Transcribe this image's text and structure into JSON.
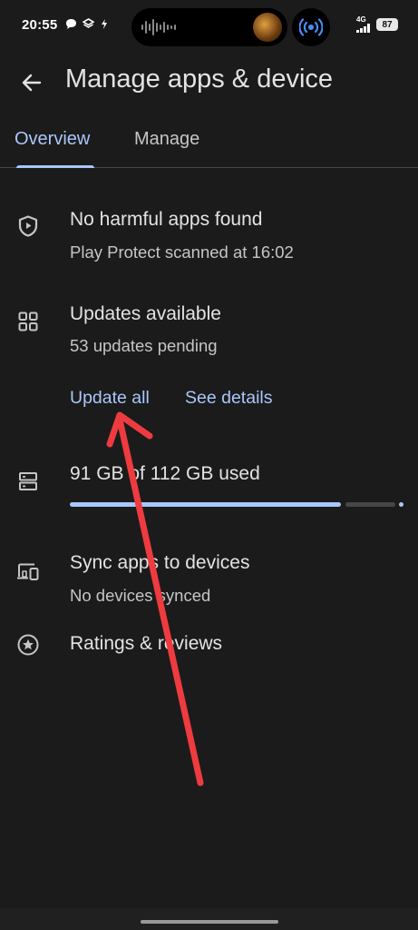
{
  "status_bar": {
    "time": "20:55",
    "network": "4G",
    "battery": "87"
  },
  "header": {
    "title": "Manage apps & device"
  },
  "tabs": [
    {
      "label": "Overview",
      "selected": true
    },
    {
      "label": "Manage",
      "selected": false
    }
  ],
  "overview": {
    "protect": {
      "title": "No harmful apps found",
      "subtitle": "Play Protect scanned at 16:02"
    },
    "updates": {
      "title": "Updates available",
      "subtitle": "53 updates pending",
      "update_all_label": "Update all",
      "see_details_label": "See details"
    },
    "storage": {
      "label": "91 GB of 112 GB used",
      "used_fraction": 0.8125
    },
    "sync": {
      "title": "Sync apps to devices",
      "subtitle": "No devices synced"
    },
    "ratings": {
      "title": "Ratings & reviews"
    }
  },
  "icons": {
    "back": "arrow-left-icon",
    "protect": "shield-play-icon",
    "updates": "apps-grid-icon",
    "storage": "storage-icon",
    "sync": "devices-icon",
    "ratings": "star-circle-icon"
  },
  "colors": {
    "background": "#1b1b1b",
    "accent": "#a8c7fa",
    "text_primary": "#e3e3e3",
    "text_secondary": "#c4c7c5",
    "annotation": "#ee3b3f"
  }
}
